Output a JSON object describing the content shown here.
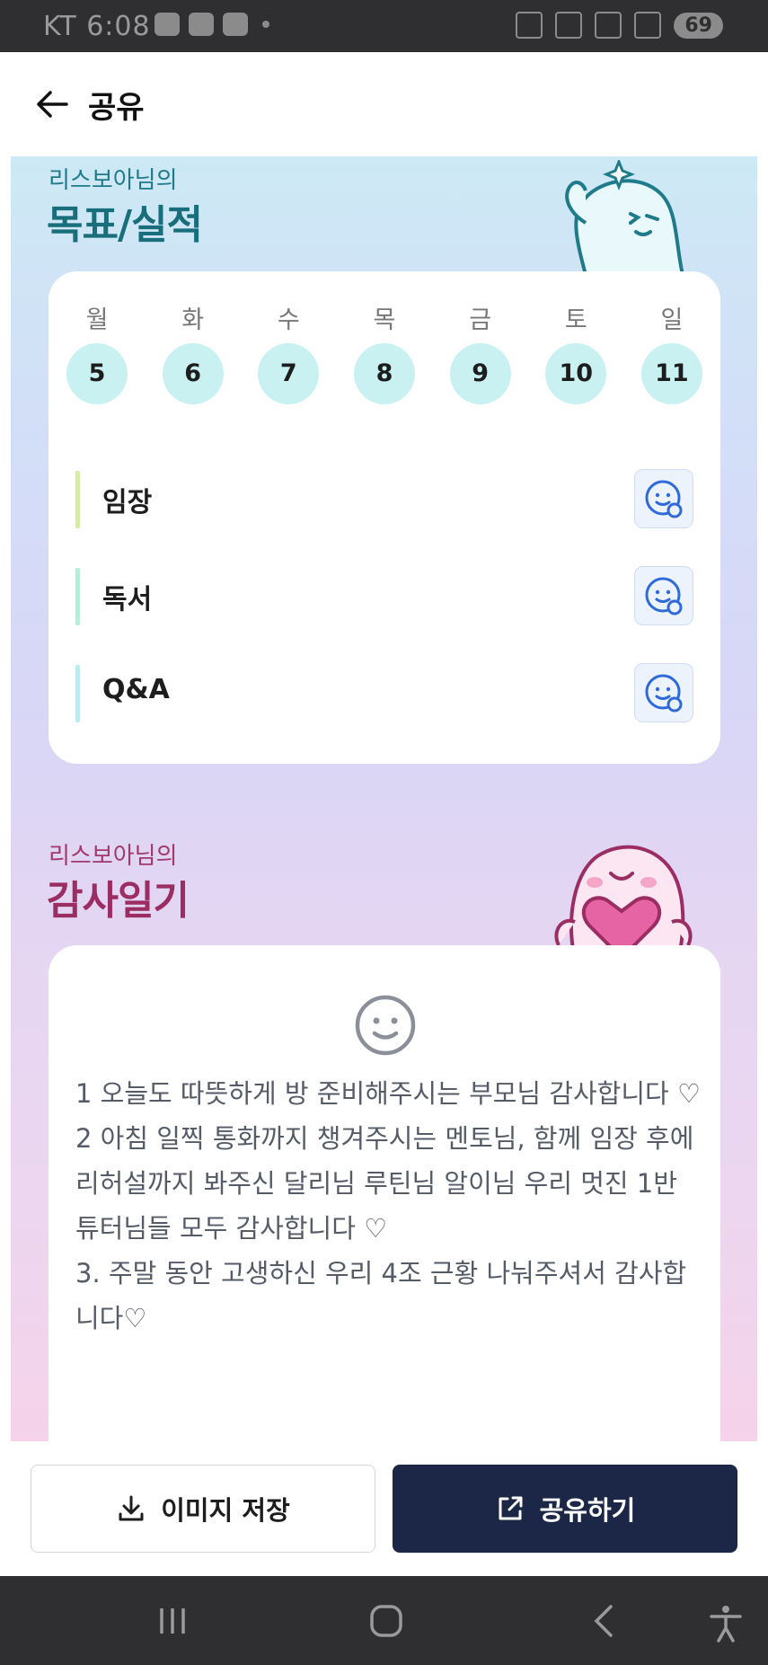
{
  "status_bar": {
    "carrier_time": "KT 6:08",
    "battery": "69"
  },
  "app_bar": {
    "title": "공유"
  },
  "goal_section": {
    "subtitle": "리스보아님의",
    "title": "목표/실적",
    "days": [
      {
        "name": "월",
        "num": "5"
      },
      {
        "name": "화",
        "num": "6"
      },
      {
        "name": "수",
        "num": "7"
      },
      {
        "name": "목",
        "num": "8"
      },
      {
        "name": "금",
        "num": "9"
      },
      {
        "name": "토",
        "num": "10"
      },
      {
        "name": "일",
        "num": "11"
      }
    ],
    "goals": [
      {
        "label": "임장",
        "accent": "#d4ecaa"
      },
      {
        "label": "독서",
        "accent": "#b8ecd9"
      },
      {
        "label": "Q&A",
        "accent": "#bdeaf0"
      }
    ]
  },
  "diary_section": {
    "subtitle": "리스보아님의",
    "title": "감사일기",
    "text": "1 오늘도 따뜻하게 방 준비해주시는 부모님 감사합니다 ♡\n2 아침 일찍 통화까지 챙겨주시는 멘토님, 함께 임장 후에 리허설까지 봐주신 달리님 루틴님 알이님 우리 멋진 1반 튜터님들 모두 감사합니다 ♡\n3. 주말 동안 고생하신 우리 4조 근황 나눠주셔서 감사합니다♡"
  },
  "actions": {
    "save_label": "이미지 저장",
    "share_label": "공유하기"
  },
  "colors": {
    "primary_button": "#1c2747",
    "goal_title": "#186e7a",
    "diary_title": "#9b2d63",
    "day_circle": "#c9f1f2"
  }
}
